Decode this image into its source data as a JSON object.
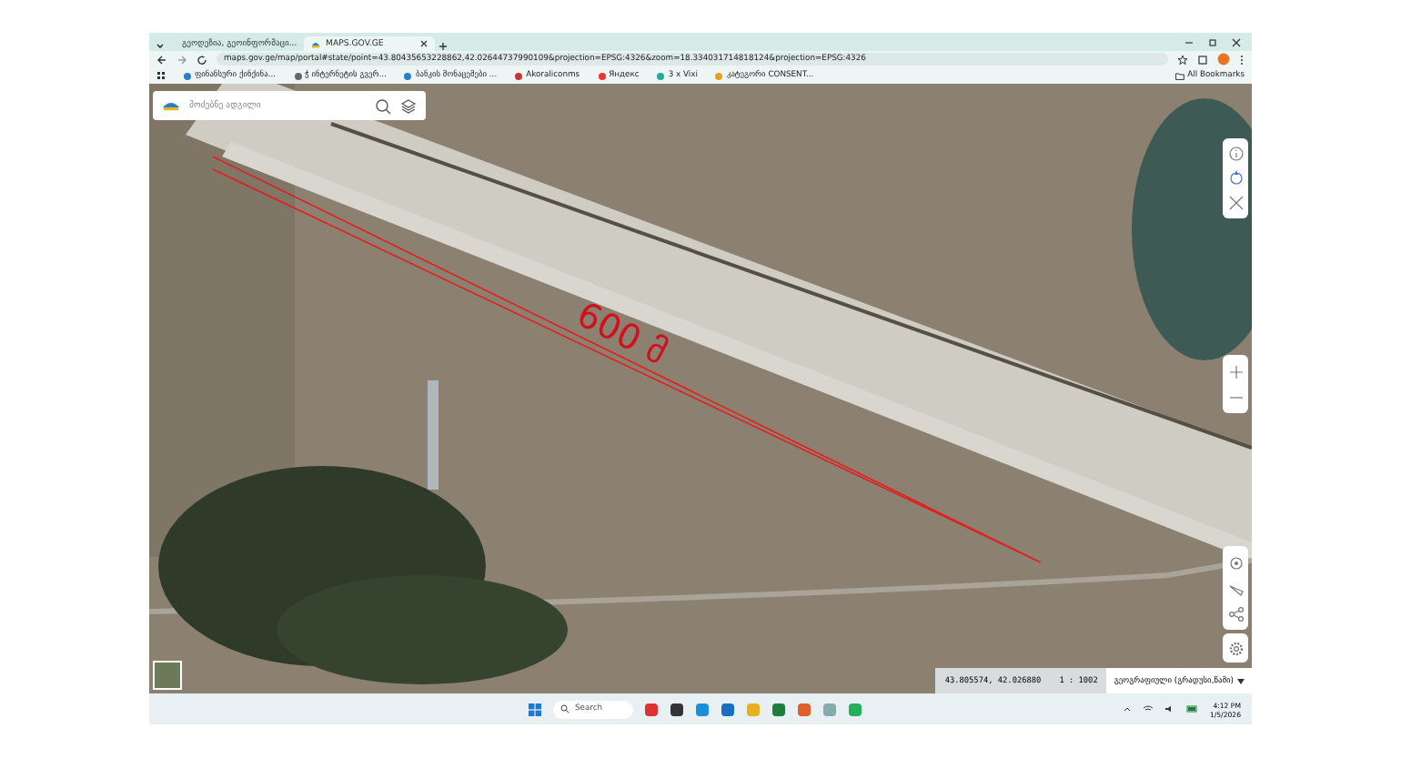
{
  "browser": {
    "tabs": [
      {
        "title": "გეოდეზია, გეოინფორმაცი...",
        "selected": false
      },
      {
        "title": "MAPS.GOV.GE",
        "selected": true
      }
    ],
    "address": "maps.gov.ge/map/portal#state/point=43.80435653228862,42.02644737990109&projection=EPSG:4326&zoom=18.334031714818124&projection=EPSG:4326",
    "bookmarks": [
      "ფინანსური ქინქინა...",
      "ჭ ინტერნეტის გვერ...",
      "ბანკის მონაცემები ...",
      "Akoraliconms",
      "Яндекс",
      "3 x Vixi",
      "კატეგორი CONSENT..."
    ],
    "all_bookmarks": "All Bookmarks"
  },
  "map": {
    "search": {
      "placeholder": "მოძებნე ადგილი"
    },
    "measurement": "600 მ",
    "coordinates": "43.805574, 42.026880",
    "scale": "1 : 1002",
    "coordinate_system": "გეოგრაფიული (გრადუსი,წამი)"
  },
  "taskbar": {
    "search": "Search",
    "time": "4:12 PM",
    "date": "1/5/2026"
  }
}
